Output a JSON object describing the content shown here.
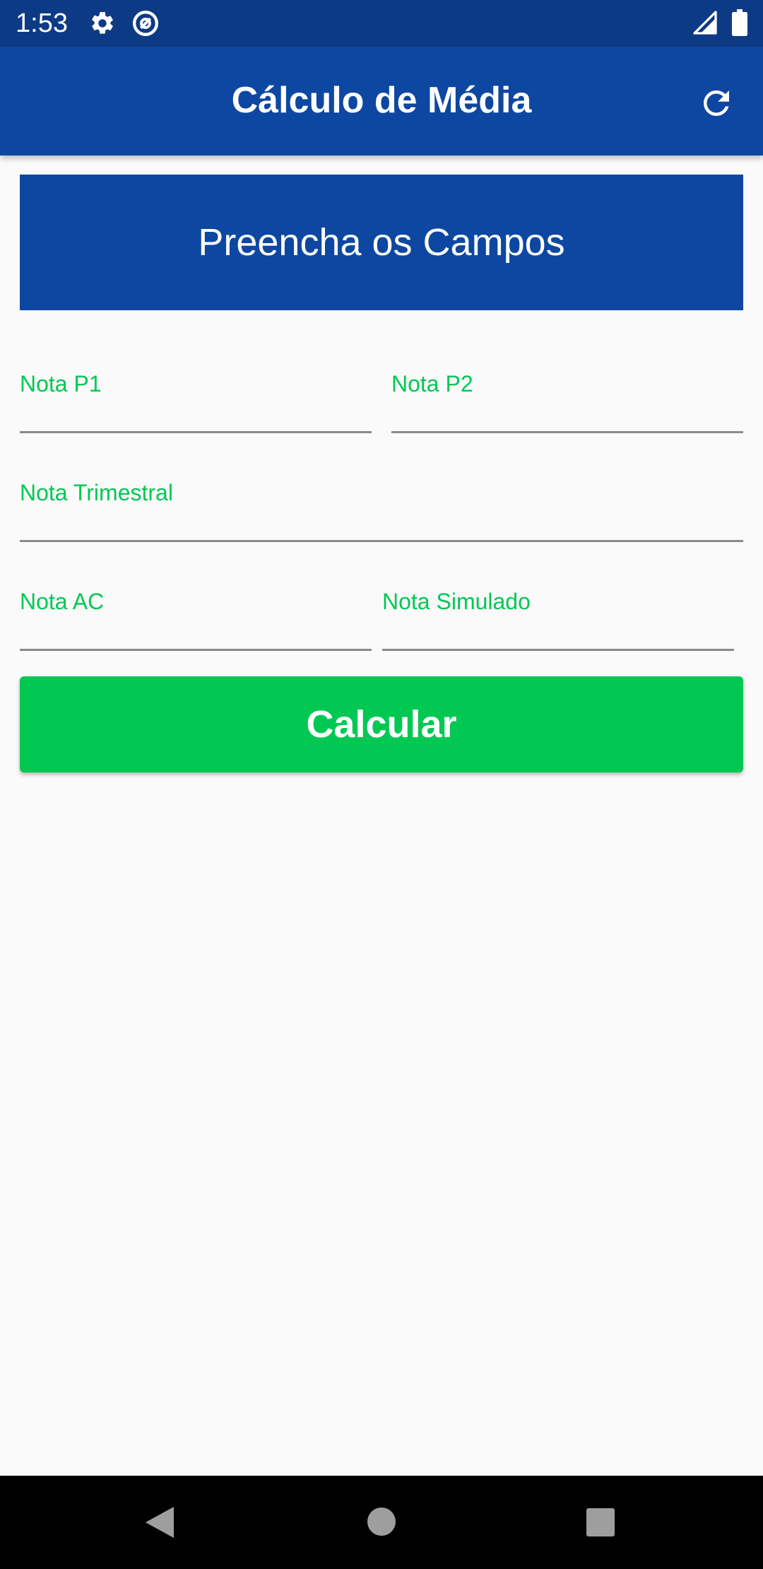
{
  "status_bar": {
    "time": "1:53",
    "icons": [
      "settings-icon",
      "at-sign-icon",
      "signal-icon",
      "battery-icon"
    ]
  },
  "app_bar": {
    "title": "Cálculo de Média",
    "action_icon": "refresh-icon"
  },
  "banner": {
    "text": "Preencha os Campos"
  },
  "form": {
    "nota_p1": {
      "label": "Nota P1",
      "value": ""
    },
    "nota_p2": {
      "label": "Nota P2",
      "value": ""
    },
    "nota_trimestral": {
      "label": "Nota Trimestral",
      "value": ""
    },
    "nota_ac": {
      "label": "Nota AC",
      "value": ""
    },
    "nota_simulado": {
      "label": "Nota Simulado",
      "value": ""
    }
  },
  "calculate_button": {
    "label": "Calcular"
  },
  "nav_bar": {
    "buttons": [
      "back-icon",
      "home-icon",
      "recents-icon"
    ]
  },
  "colors": {
    "status_bar": "#0d3a84",
    "primary": "#0d47a1",
    "accent": "#00c853",
    "background": "#fafafa"
  }
}
